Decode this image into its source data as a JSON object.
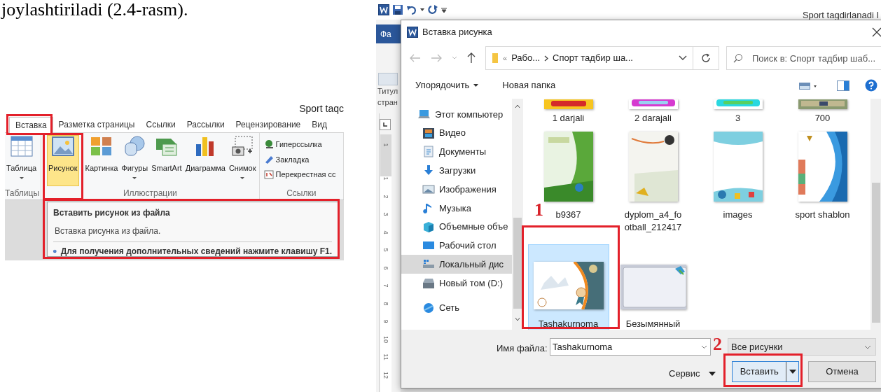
{
  "caption": "joylashtiriladi (2.4-rasm).",
  "ribbon_window": {
    "title": "Sport taqc",
    "tabs": [
      {
        "label": "Вставка",
        "selected": true
      },
      {
        "label": "Разметка страницы",
        "selected": false
      },
      {
        "label": "Ссылки",
        "selected": false
      },
      {
        "label": "Рассылки",
        "selected": false
      },
      {
        "label": "Рецензирование",
        "selected": false
      },
      {
        "label": "Вид",
        "selected": false
      }
    ],
    "groups": [
      {
        "kind": "large",
        "label": "Таблицы",
        "buttons": [
          {
            "kind": "table",
            "label": "Таблица",
            "dropdown": true,
            "selected": false
          }
        ]
      },
      {
        "kind": "large",
        "label": "Иллюстрации",
        "buttons": [
          {
            "kind": "picture",
            "label": "Рисунок",
            "dropdown": false,
            "selected": true
          },
          {
            "kind": "clipart",
            "label": "Картинка",
            "dropdown": false,
            "selected": false
          },
          {
            "kind": "shapes",
            "label": "Фигуры",
            "dropdown": true,
            "selected": false
          },
          {
            "kind": "smartart",
            "label": "SmartArt",
            "dropdown": false,
            "selected": false
          },
          {
            "kind": "chart",
            "label": "Диаграмма",
            "dropdown": false,
            "selected": false
          },
          {
            "kind": "screenshot",
            "label": "Снимок",
            "dropdown": true,
            "selected": false
          }
        ]
      },
      {
        "kind": "small",
        "label": "Ссылки",
        "buttons": [
          {
            "kind": "hyperlink",
            "label": "Гиперссылка"
          },
          {
            "kind": "bookmark",
            "label": "Закладка"
          },
          {
            "kind": "crossref",
            "label": "Перекрестная сс"
          }
        ]
      }
    ],
    "tooltip": {
      "title": "Вставить рисунок из файла",
      "description": "Вставка рисунка из файла.",
      "help": "Для получения дополнительных сведений нажмите клавишу F1."
    }
  },
  "word_window": {
    "title": "Sport tagdirlanadi I",
    "file_tab": "Фа",
    "ribbon_label": [
      "Титул",
      "стран"
    ],
    "ruler_marks": [
      "1",
      "1",
      "2",
      "3",
      "4",
      "5",
      "6",
      "7",
      "8",
      "9",
      "10",
      "11",
      "12"
    ]
  },
  "dialog": {
    "title": "Вставка рисунка",
    "path_prefix": "«",
    "path": [
      "Рабо...",
      "Спорт тадбир ша..."
    ],
    "search": {
      "placeholder": "Поиск в: Спорт тадбир шаб..."
    },
    "toolbar": {
      "organize": "Упорядочить",
      "new_folder": "Новая папка"
    },
    "sidebar": [
      {
        "kind": "computer",
        "label": "Этот компьютер",
        "selected": false
      },
      {
        "kind": "video",
        "label": "Видео",
        "selected": false
      },
      {
        "kind": "documents",
        "label": "Документы",
        "selected": false
      },
      {
        "kind": "downloads",
        "label": "Загрузки",
        "selected": false
      },
      {
        "kind": "images",
        "label": "Изображения",
        "selected": false
      },
      {
        "kind": "music",
        "label": "Музыка",
        "selected": false
      },
      {
        "kind": "objects",
        "label": "Объемные объе",
        "selected": false
      },
      {
        "kind": "desktop",
        "label": "Рабочий стол",
        "selected": false
      },
      {
        "kind": "disk",
        "label": "Локальный дис",
        "selected": true
      },
      {
        "kind": "drive",
        "label": "Новый том (D:)",
        "selected": false
      },
      {
        "kind": "network",
        "label": "Сеть",
        "selected": false
      }
    ],
    "files": [
      {
        "name": "1 darjali",
        "selected": false
      },
      {
        "name": "2 darajali",
        "selected": false
      },
      {
        "name": "3",
        "selected": false
      },
      {
        "name": "700",
        "selected": false
      },
      {
        "name": "b9367",
        "selected": false
      },
      {
        "name": "dyplom_a4_football_212417",
        "selected": false
      },
      {
        "name": "images",
        "selected": false
      },
      {
        "name": "sport shablon",
        "selected": false
      },
      {
        "name": "Tashakurnoma",
        "selected": true
      },
      {
        "name": "Безымянный",
        "selected": false
      }
    ],
    "file_name_label": "Имя файла:",
    "file_name": "Tashakurnoma",
    "file_type": "Все рисунки",
    "tools": "Сервис",
    "insert": "Вставить",
    "cancel": "Отмена"
  },
  "annotations": [
    "1",
    "2"
  ]
}
